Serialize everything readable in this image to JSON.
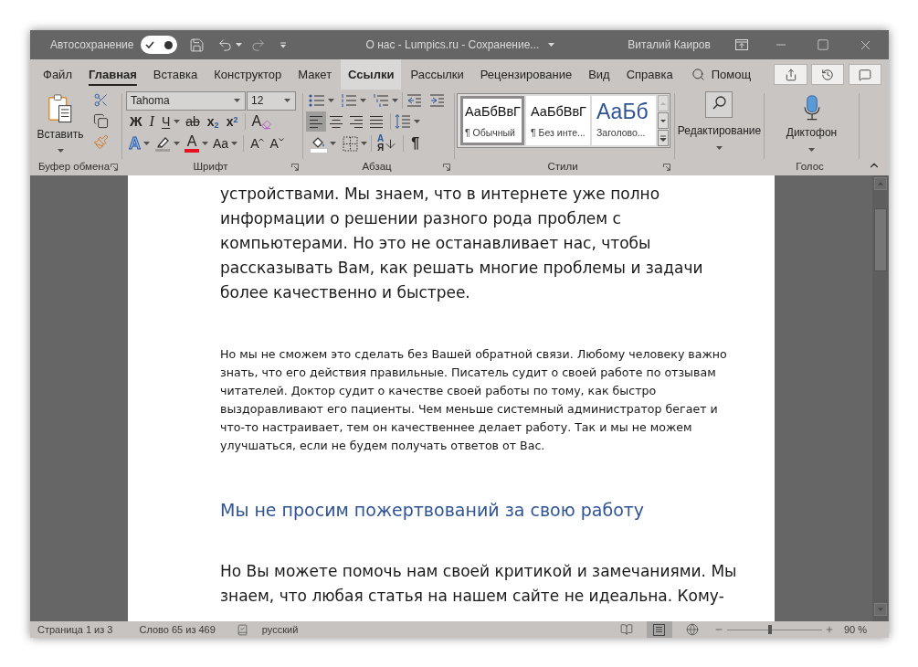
{
  "title_bar": {
    "autosave_label": "Автосохранение",
    "autosave_on": true,
    "document_title": "О нас - Lumpics.ru - Сохранение...",
    "user_name": "Виталий Каиров"
  },
  "tabs": [
    {
      "label": "Файл",
      "selected": false,
      "hovered": false
    },
    {
      "label": "Главная",
      "selected": true,
      "hovered": false
    },
    {
      "label": "Вставка",
      "selected": false,
      "hovered": false
    },
    {
      "label": "Конструктор",
      "selected": false,
      "hovered": false
    },
    {
      "label": "Макет",
      "selected": false,
      "hovered": false
    },
    {
      "label": "Ссылки",
      "selected": false,
      "hovered": true
    },
    {
      "label": "Рассылки",
      "selected": false,
      "hovered": false
    },
    {
      "label": "Рецензирование",
      "selected": false,
      "hovered": false
    },
    {
      "label": "Вид",
      "selected": false,
      "hovered": false
    },
    {
      "label": "Справка",
      "selected": false,
      "hovered": false
    }
  ],
  "tell_me": {
    "label": "Помощ"
  },
  "clipboard": {
    "paste_label": "Вставить",
    "group_label": "Буфер обмена"
  },
  "font": {
    "font_name": "Tahoma",
    "font_size": "12",
    "style_buttons": [
      {
        "kind": "bold",
        "text": "Ж",
        "dropdown": false
      },
      {
        "kind": "italic",
        "text": "I",
        "dropdown": false
      },
      {
        "kind": "underline",
        "text": "Ч",
        "dropdown": true
      },
      {
        "kind": "strikethrough",
        "text": "ab",
        "dropdown": false
      },
      {
        "kind": "subscript",
        "text": "x$_{2}$",
        "dropdown": false
      },
      {
        "kind": "superscript",
        "text": "x$^{2}$",
        "dropdown": false
      }
    ],
    "clear_formatting": "A",
    "effect_buttons": [
      {
        "kind": "text_effects",
        "text": "A",
        "dropdown": true
      },
      {
        "kind": "highlight",
        "dropdown": true
      },
      {
        "kind": "font_color",
        "text": "A",
        "dropdown": true
      },
      {
        "kind": "change_case",
        "text": "Aa",
        "dropdown": true
      }
    ],
    "size_buttons": [
      {
        "kind": "grow",
        "text": "A"
      },
      {
        "kind": "shrink",
        "text": "A"
      }
    ],
    "group_label": "Шрифт"
  },
  "paragraph": {
    "alignment": [
      {
        "kind": "left",
        "selected": true
      },
      {
        "kind": "center",
        "selected": false
      },
      {
        "kind": "right",
        "selected": false
      },
      {
        "kind": "justify",
        "selected": false
      }
    ],
    "sort": {
      "top": "А",
      "bottom": "Я"
    },
    "marks": "¶",
    "group_label": "Абзац"
  },
  "styles": {
    "items": [
      {
        "kind": "normal",
        "preview": "АаБбВвГ",
        "name": "¶ Обычный",
        "selected": true
      },
      {
        "kind": "normal",
        "preview": "АаБбВвГ",
        "name": "¶ Без инте...",
        "selected": false
      },
      {
        "kind": "heading",
        "preview": "АаБб",
        "name": "Заголово...",
        "selected": false
      }
    ],
    "group_label": "Стили"
  },
  "editing": {
    "label": "Редактирование"
  },
  "voice": {
    "label": "Диктофон",
    "group_label": "Голос"
  },
  "document": {
    "paragraphs": [
      {
        "kind": "large",
        "text": "устройствами. Мы знаем, что в интернете уже полно информации о решении разного рода проблем с компьютерами. Но это не останавливает нас, чтобы рассказывать Вам, как решать многие проблемы и задачи более качественно и быстрее."
      },
      {
        "kind": "small",
        "text": "Но мы не сможем это сделать без Вашей обратной связи. Любому человеку важно знать, что его действия правильные. Писатель судит о своей работе по отзывам читателей. Доктор судит о качестве своей работы по тому, как быстро выздоравливают его пациенты. Чем меньше системный администратор бегает и что-то настраивает, тем он качественнее делает работу. Так и мы не можем улучшаться, если не будем получать ответов от Вас."
      },
      {
        "kind": "heading",
        "text": "Мы не просим пожертвований за свою работу"
      },
      {
        "kind": "large",
        "text": "Но Вы можете помочь нам своей критикой и замечаниями. Мы знаем, что любая статья на нашем сайте не идеальна. Кому-"
      }
    ]
  },
  "status_bar": {
    "page": "Страница 1 из 3",
    "words": "Слово 65 из 469",
    "language": "русский",
    "views": [
      {
        "kind": "read",
        "selected": false
      },
      {
        "kind": "print",
        "selected": true
      },
      {
        "kind": "web",
        "selected": false
      }
    ],
    "zoom": {
      "level": 0.45,
      "reading": "90 %"
    }
  }
}
